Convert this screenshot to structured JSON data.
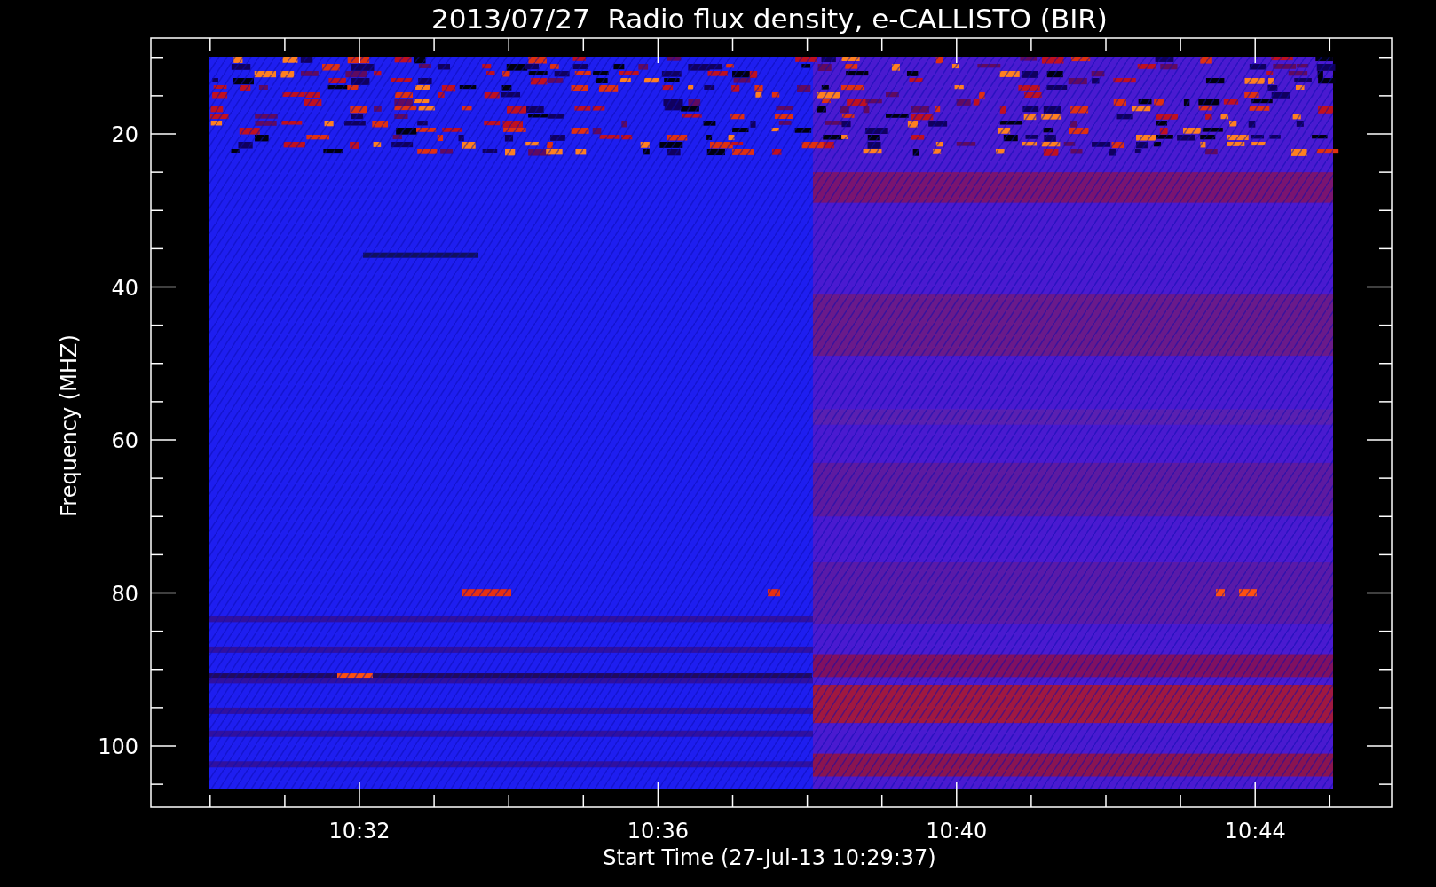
{
  "title": "2013/07/27  Radio flux density, e-CALLISTO (BIR)",
  "y_axis": {
    "label": "Frequency (MHZ)",
    "ticks": [
      "20",
      "40",
      "60",
      "80",
      "100"
    ]
  },
  "x_axis": {
    "label": "Start Time (27-Jul-13 10:29:37)",
    "ticks": [
      "10:32",
      "10:36",
      "10:40",
      "10:44"
    ]
  }
}
